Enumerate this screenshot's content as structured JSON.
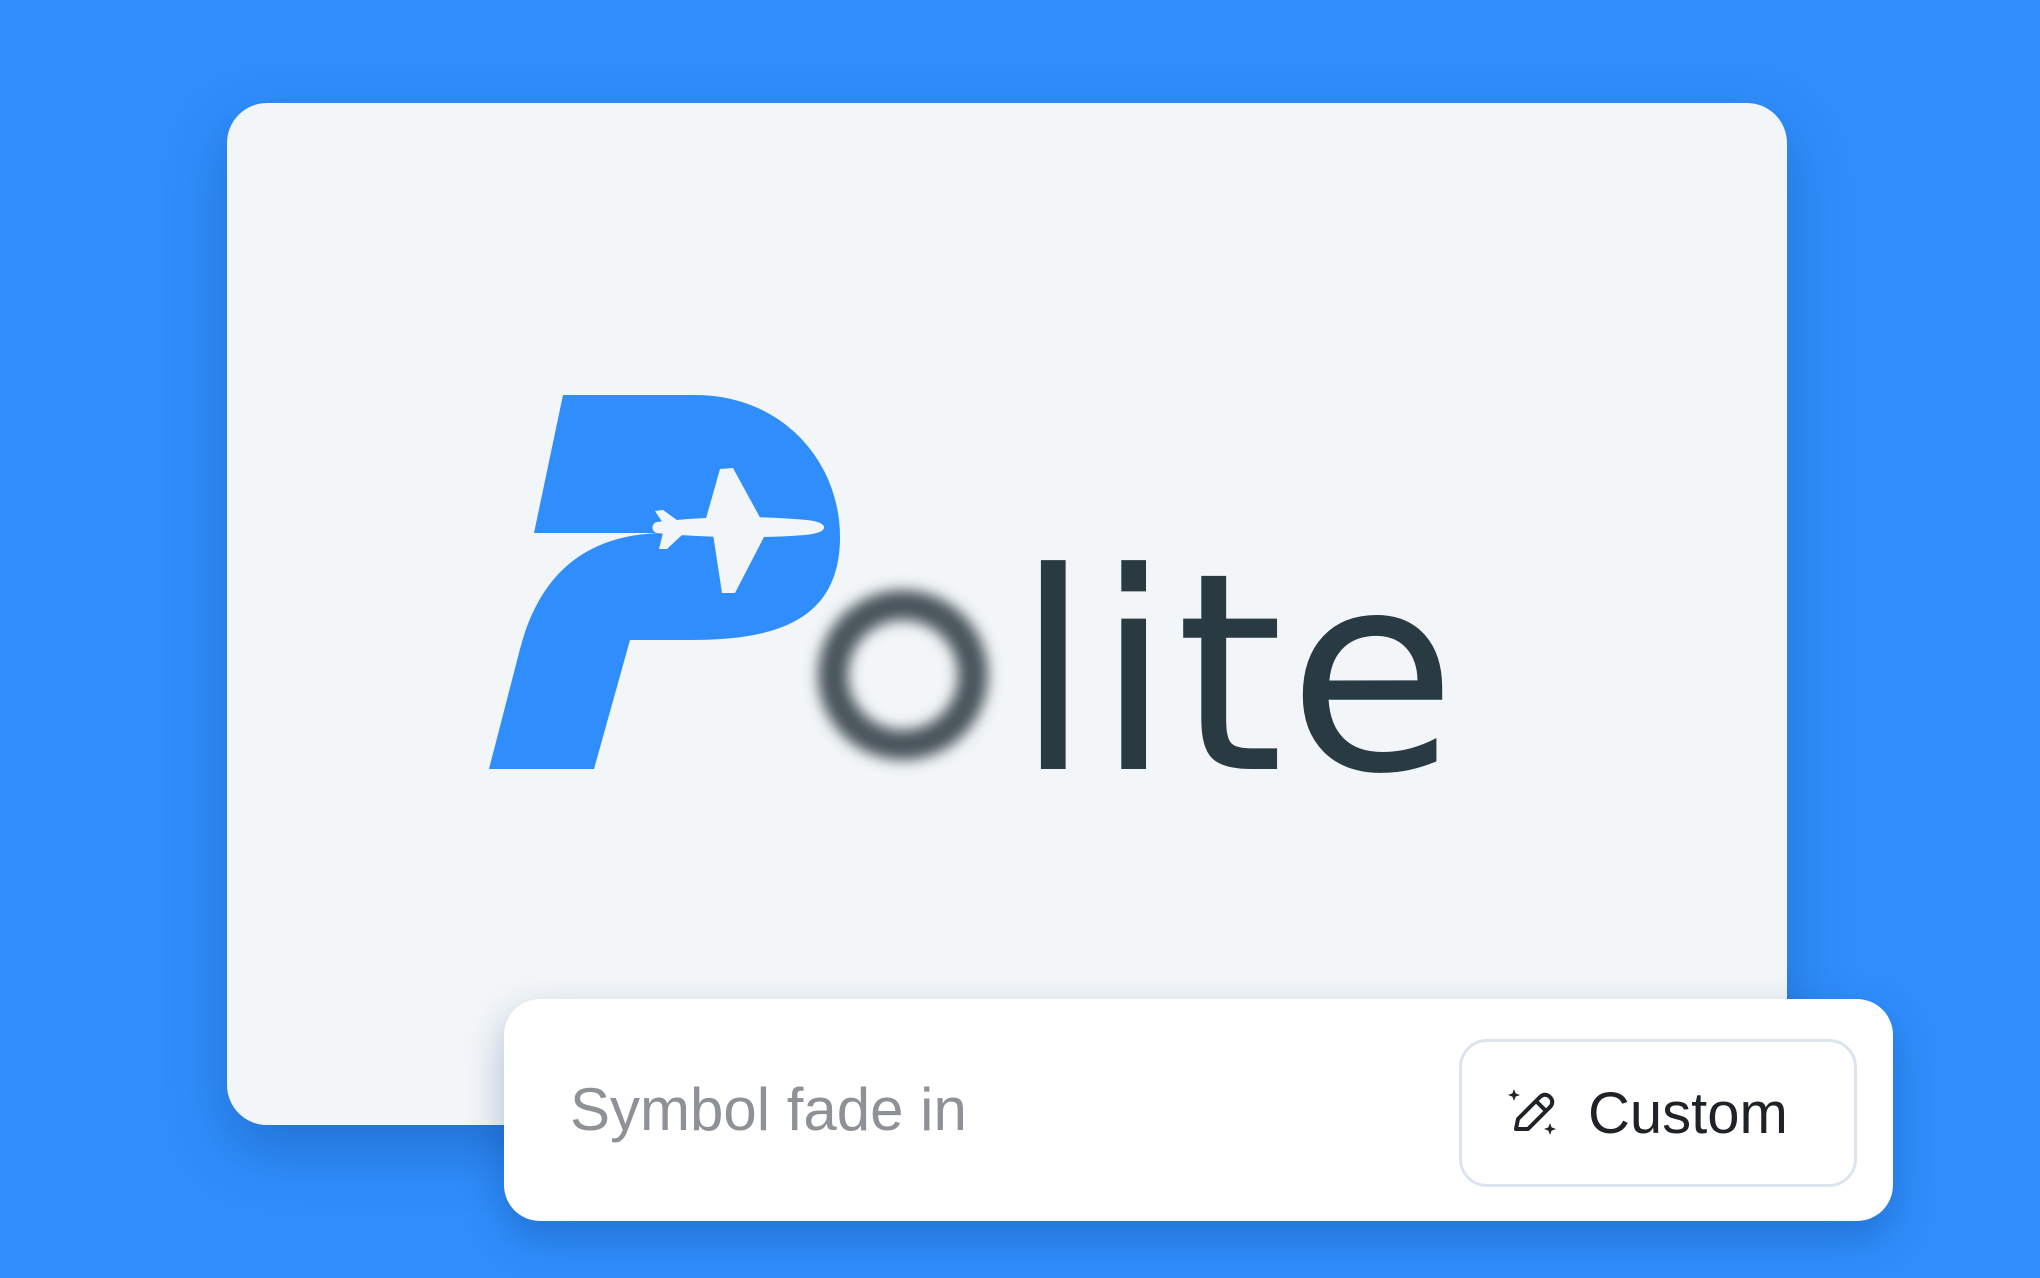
{
  "logo": {
    "symbol_letter": "P",
    "blurred_letter": "o",
    "wordmark_rest": "lite",
    "symbol_color": "#2F8EFB",
    "wordmark_color": "#293A43",
    "symbol_icon": "airplane-icon"
  },
  "animation_option": {
    "label": "Symbol fade in",
    "custom_button_label": "Custom",
    "custom_button_icon": "magic-pencil-icon"
  },
  "colors": {
    "background": "#2F8EFB",
    "card": "#F2F6F8",
    "text_muted": "#8E9296"
  }
}
